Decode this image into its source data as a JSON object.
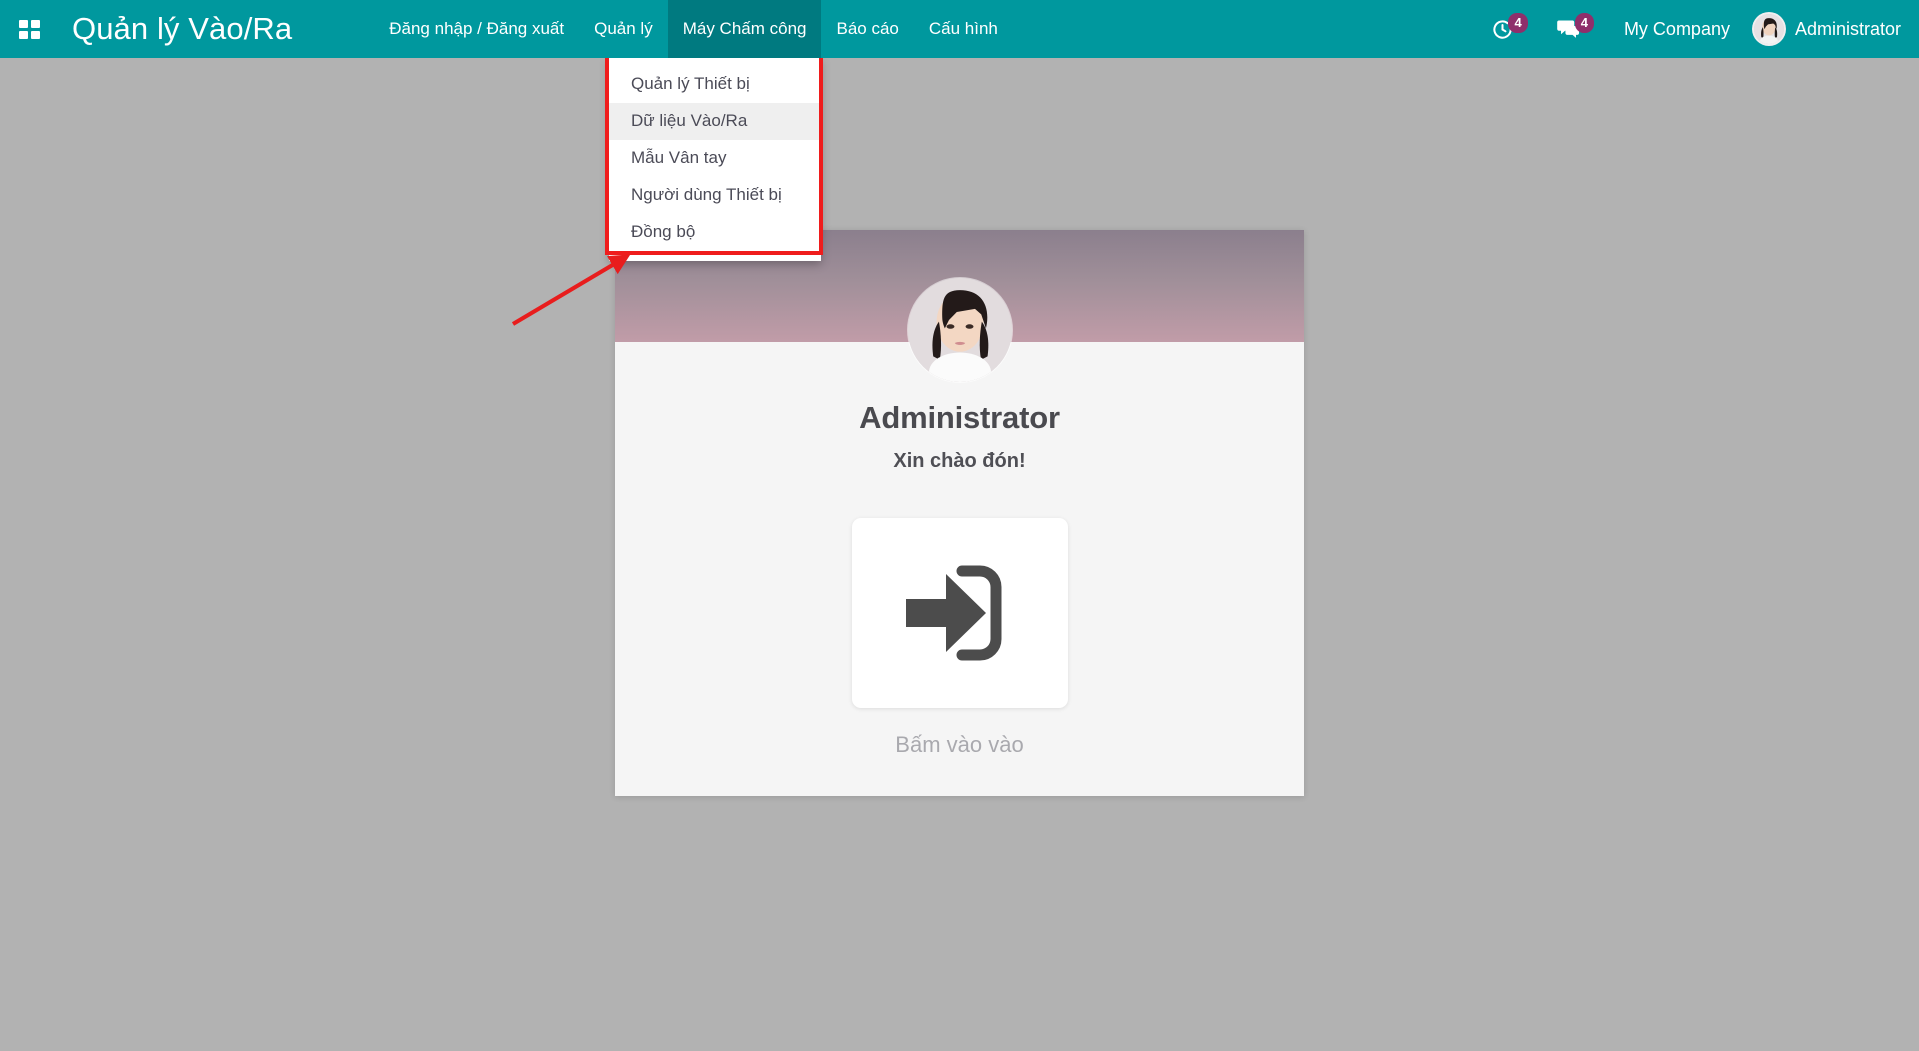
{
  "navbar": {
    "apps_icon": "apps-grid-icon",
    "brand": "Quản lý Vào/Ra",
    "accent_color": "#00989e",
    "active_menu_color": "#007a80",
    "menus": [
      {
        "label": "Đăng nhập / Đăng xuất",
        "active": false
      },
      {
        "label": "Quản lý",
        "active": false
      },
      {
        "label": "Máy Chấm công",
        "active": true
      },
      {
        "label": "Báo cáo",
        "active": false
      },
      {
        "label": "Cấu hình",
        "active": false
      }
    ],
    "right": {
      "activities_icon": "clock-activity-icon",
      "activities_count": "4",
      "messages_icon": "chat-bubble-icon",
      "messages_count": "4",
      "badge_color": "#8f2f6b",
      "company": "My Company",
      "user_avatar_icon": "user-avatar-icon",
      "user": "Administrator"
    }
  },
  "dropdown": {
    "open_for": "Máy Chấm công",
    "items": [
      {
        "label": "Quản lý Thiết bị",
        "highlighted": false
      },
      {
        "label": "Dữ liệu Vào/Ra",
        "highlighted": true
      },
      {
        "label": "Mẫu Vân tay",
        "highlighted": false
      },
      {
        "label": "Người dùng Thiết bị",
        "highlighted": false
      },
      {
        "label": "Đồng bộ",
        "highlighted": false
      }
    ]
  },
  "annotation": {
    "highlight_box_color": "#ef1c1c",
    "arrow_icon": "red-arrow-icon",
    "arrow_color": "#e81d1d"
  },
  "card": {
    "banner_gradient_from": "#8b7f8d",
    "banner_gradient_to": "#c19ca8",
    "avatar_icon": "user-photo-avatar",
    "user_name": "Administrator",
    "welcome_message": "Xin chào đón!",
    "checkin": {
      "icon": "sign-in-arrow-icon",
      "label": "Bấm vào vào"
    }
  },
  "page": {
    "background_color": "#b2b2b2"
  }
}
